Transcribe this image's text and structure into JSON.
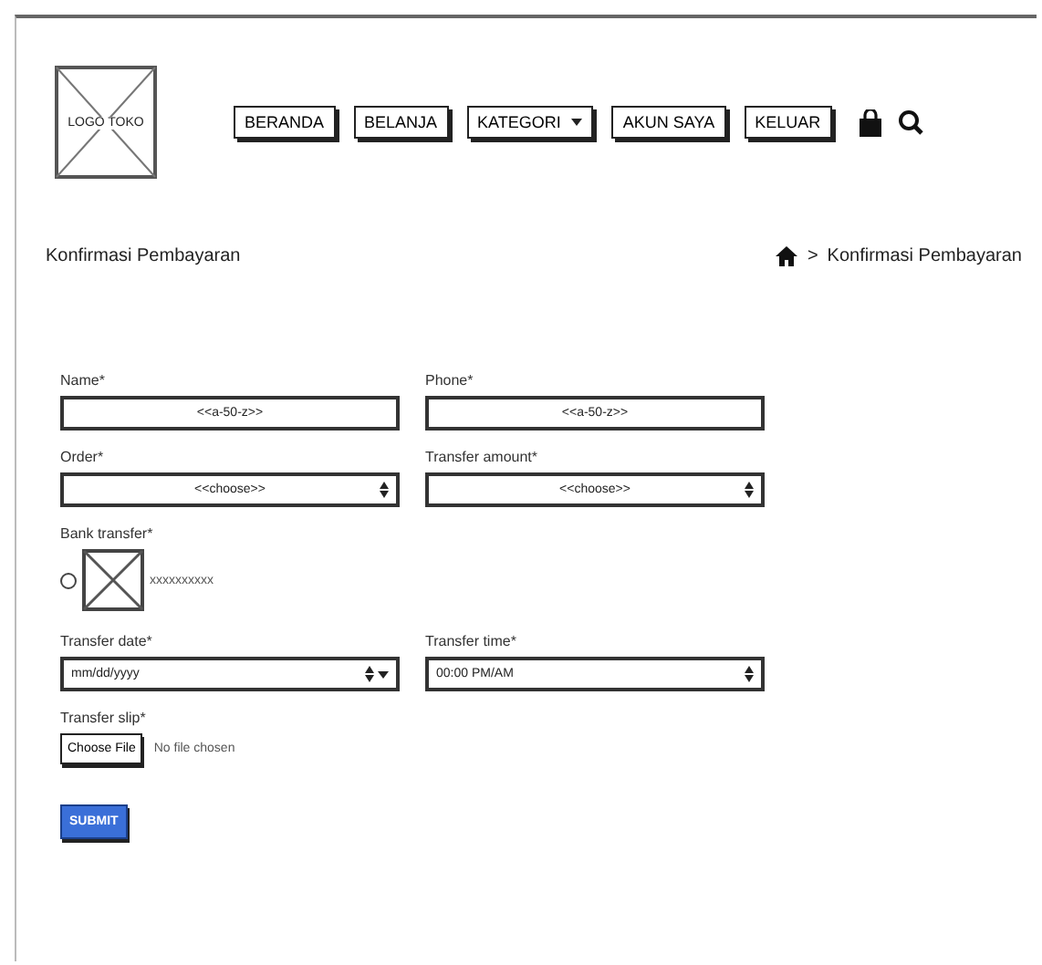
{
  "header": {
    "logo": "LOGO TOKO",
    "nav": [
      {
        "label": "BERANDA",
        "kind": "button"
      },
      {
        "label": "BELANJA",
        "kind": "button"
      },
      {
        "label": "KATEGORI",
        "kind": "dropdown"
      },
      {
        "label": "AKUN SAYA",
        "kind": "button"
      },
      {
        "label": "KELUAR",
        "kind": "button"
      }
    ]
  },
  "page_title": "Konfirmasi Pembayaran",
  "breadcrumb": {
    "separator": ">",
    "current": "Konfirmasi Pembayaran"
  },
  "form": {
    "rows": [
      [
        {
          "label": "Name*",
          "kind": "text",
          "value": "<<a-50-z>>"
        },
        {
          "label": "Phone*",
          "kind": "text",
          "value": "<<a-50-z>>"
        }
      ],
      [
        {
          "label": "Order*",
          "kind": "select",
          "value": "<<choose>>"
        },
        {
          "label": "Transfer amount*",
          "kind": "select",
          "value": "<<choose>>"
        }
      ]
    ],
    "bank": {
      "label": "Bank transfer*",
      "options": [
        {
          "text": "xxxxxxxxxx",
          "selected": false
        }
      ]
    },
    "rows2": [
      [
        {
          "label": "Transfer date*",
          "kind": "date",
          "value": "mm/dd/yyyy"
        },
        {
          "label": "Transfer time*",
          "kind": "select",
          "value": "00:00 PM/AM"
        }
      ]
    ],
    "slip": {
      "label": "Transfer slip*",
      "button": "Choose File",
      "status": "No file chosen"
    },
    "submit": "SUBMIT"
  }
}
